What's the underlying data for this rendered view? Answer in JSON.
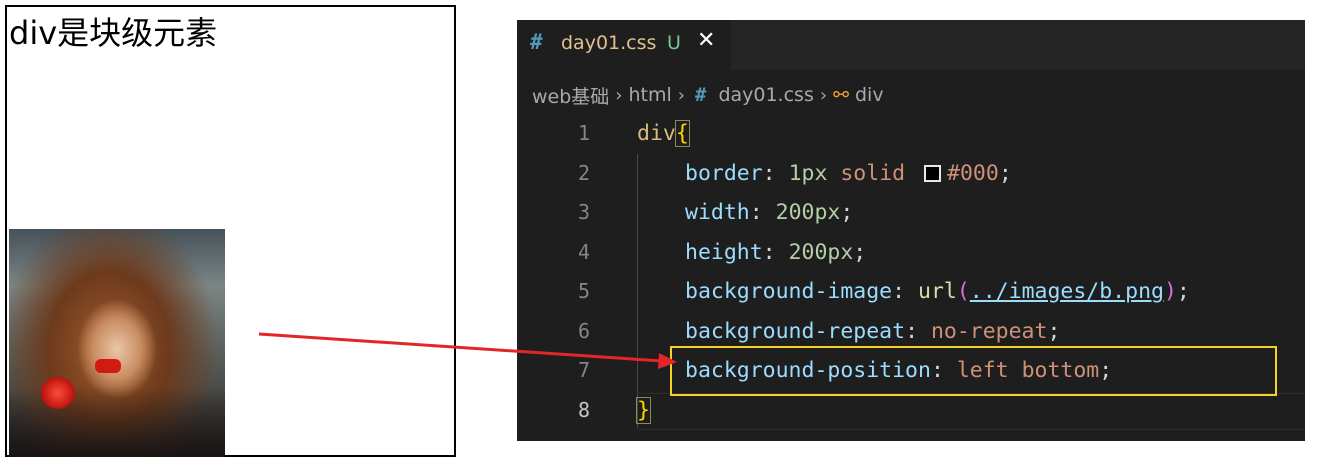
{
  "preview": {
    "text": "div是块级元素"
  },
  "editor": {
    "tab": {
      "icon": "#",
      "filename": "day01.css",
      "status": "U",
      "close": "✕"
    },
    "breadcrumb": {
      "root": "web基础",
      "folder": "html",
      "file_icon": "#",
      "file": "day01.css",
      "symbol_icon": "⚯",
      "symbol": "div"
    },
    "code": {
      "line_numbers": [
        "1",
        "2",
        "3",
        "4",
        "5",
        "6",
        "7",
        "8"
      ],
      "selector": "div",
      "open_brace": "{",
      "close_brace": "}",
      "line2": {
        "prop": "border",
        "value_num": "1px",
        "value_kw": "solid",
        "color": "#000"
      },
      "line3": {
        "prop": "width",
        "value": "200px"
      },
      "line4": {
        "prop": "height",
        "value": "200px"
      },
      "line5": {
        "prop": "background-image",
        "fn": "url",
        "arg": "../images/b.png"
      },
      "line6": {
        "prop": "background-repeat",
        "value": "no-repeat"
      },
      "line7": {
        "prop": "background-position",
        "value": "left bottom"
      }
    },
    "colors": {
      "highlight_border": "#f5d320",
      "arrow": "#e3252a",
      "swatch": "#000000"
    }
  }
}
